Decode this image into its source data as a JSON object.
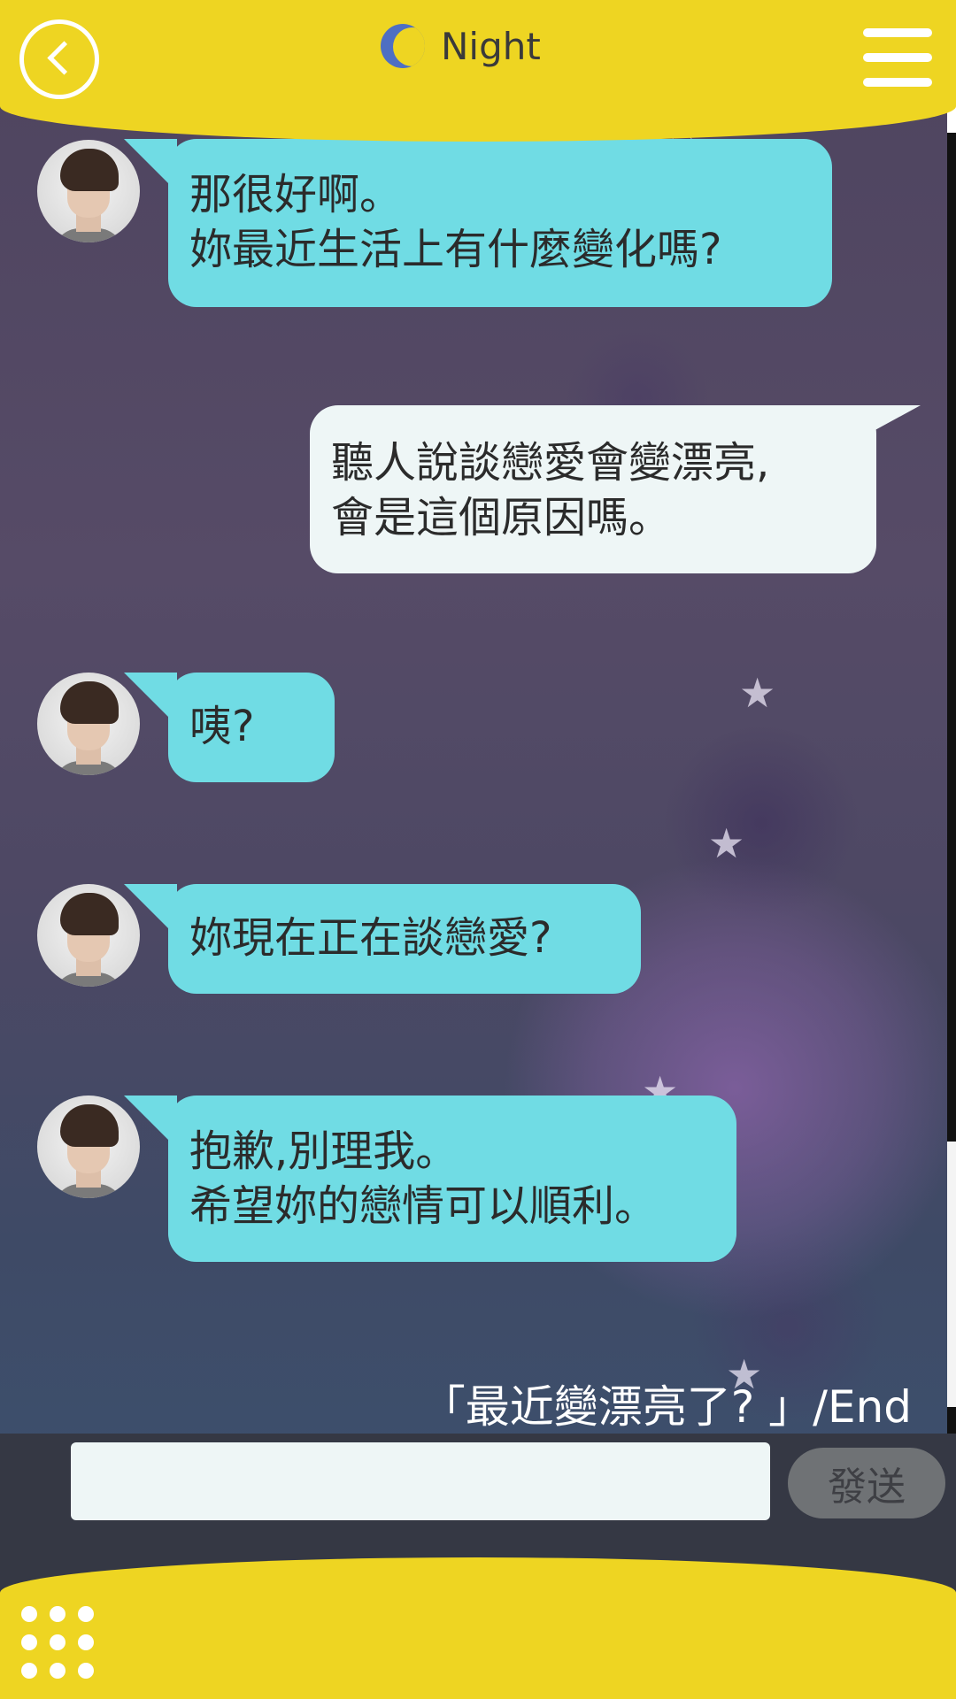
{
  "header": {
    "title": "Night",
    "moon_color": "#4e6fc3",
    "bar_color": "#eed522"
  },
  "messages": [
    {
      "side": "left",
      "lines": [
        "那很好啊。",
        "妳最近生活上有什麼變化嗎?"
      ]
    },
    {
      "side": "right",
      "lines": [
        "聽人說談戀愛會變漂亮,",
        "會是這個原因嗎。"
      ]
    },
    {
      "side": "left",
      "lines": [
        "咦?"
      ]
    },
    {
      "side": "left",
      "lines": [
        "妳現在正在談戀愛?"
      ]
    },
    {
      "side": "left",
      "lines": [
        "抱歉,別理我。",
        "希望妳的戀情可以順利。"
      ]
    }
  ],
  "footer_note": "「最近變漂亮了? 」/End",
  "input": {
    "value": "",
    "placeholder": ""
  },
  "send_label": "發送",
  "colors": {
    "left_bubble": "#70dce4",
    "right_bubble": "#eef6f6",
    "input_bar": "#353844"
  },
  "icons": [
    "back-icon",
    "moon-icon",
    "menu-icon",
    "grid-menu-icon",
    "avatar"
  ]
}
